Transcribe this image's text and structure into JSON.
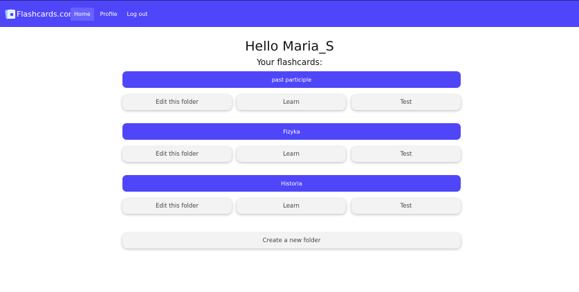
{
  "navbar": {
    "brand": "Flashcards.com",
    "links": [
      {
        "label": "Home"
      },
      {
        "label": "Profile"
      },
      {
        "label": "Log out"
      }
    ]
  },
  "main": {
    "greeting": "Hello Maria_S",
    "subtitle": "Your flashcards:",
    "folders": [
      {
        "name": "past participle",
        "actions": {
          "edit": "Edit this folder",
          "learn": "Learn",
          "test": "Test"
        }
      },
      {
        "name": "Fizyka",
        "actions": {
          "edit": "Edit this folder",
          "learn": "Learn",
          "test": "Test"
        }
      },
      {
        "name": "Historia",
        "actions": {
          "edit": "Edit this folder",
          "learn": "Learn",
          "test": "Test"
        }
      }
    ],
    "create_label": "Create a new folder"
  },
  "colors": {
    "primary": "#4f46fa",
    "nav_active": "#6761ff",
    "button_bg": "#f3f3f3"
  }
}
